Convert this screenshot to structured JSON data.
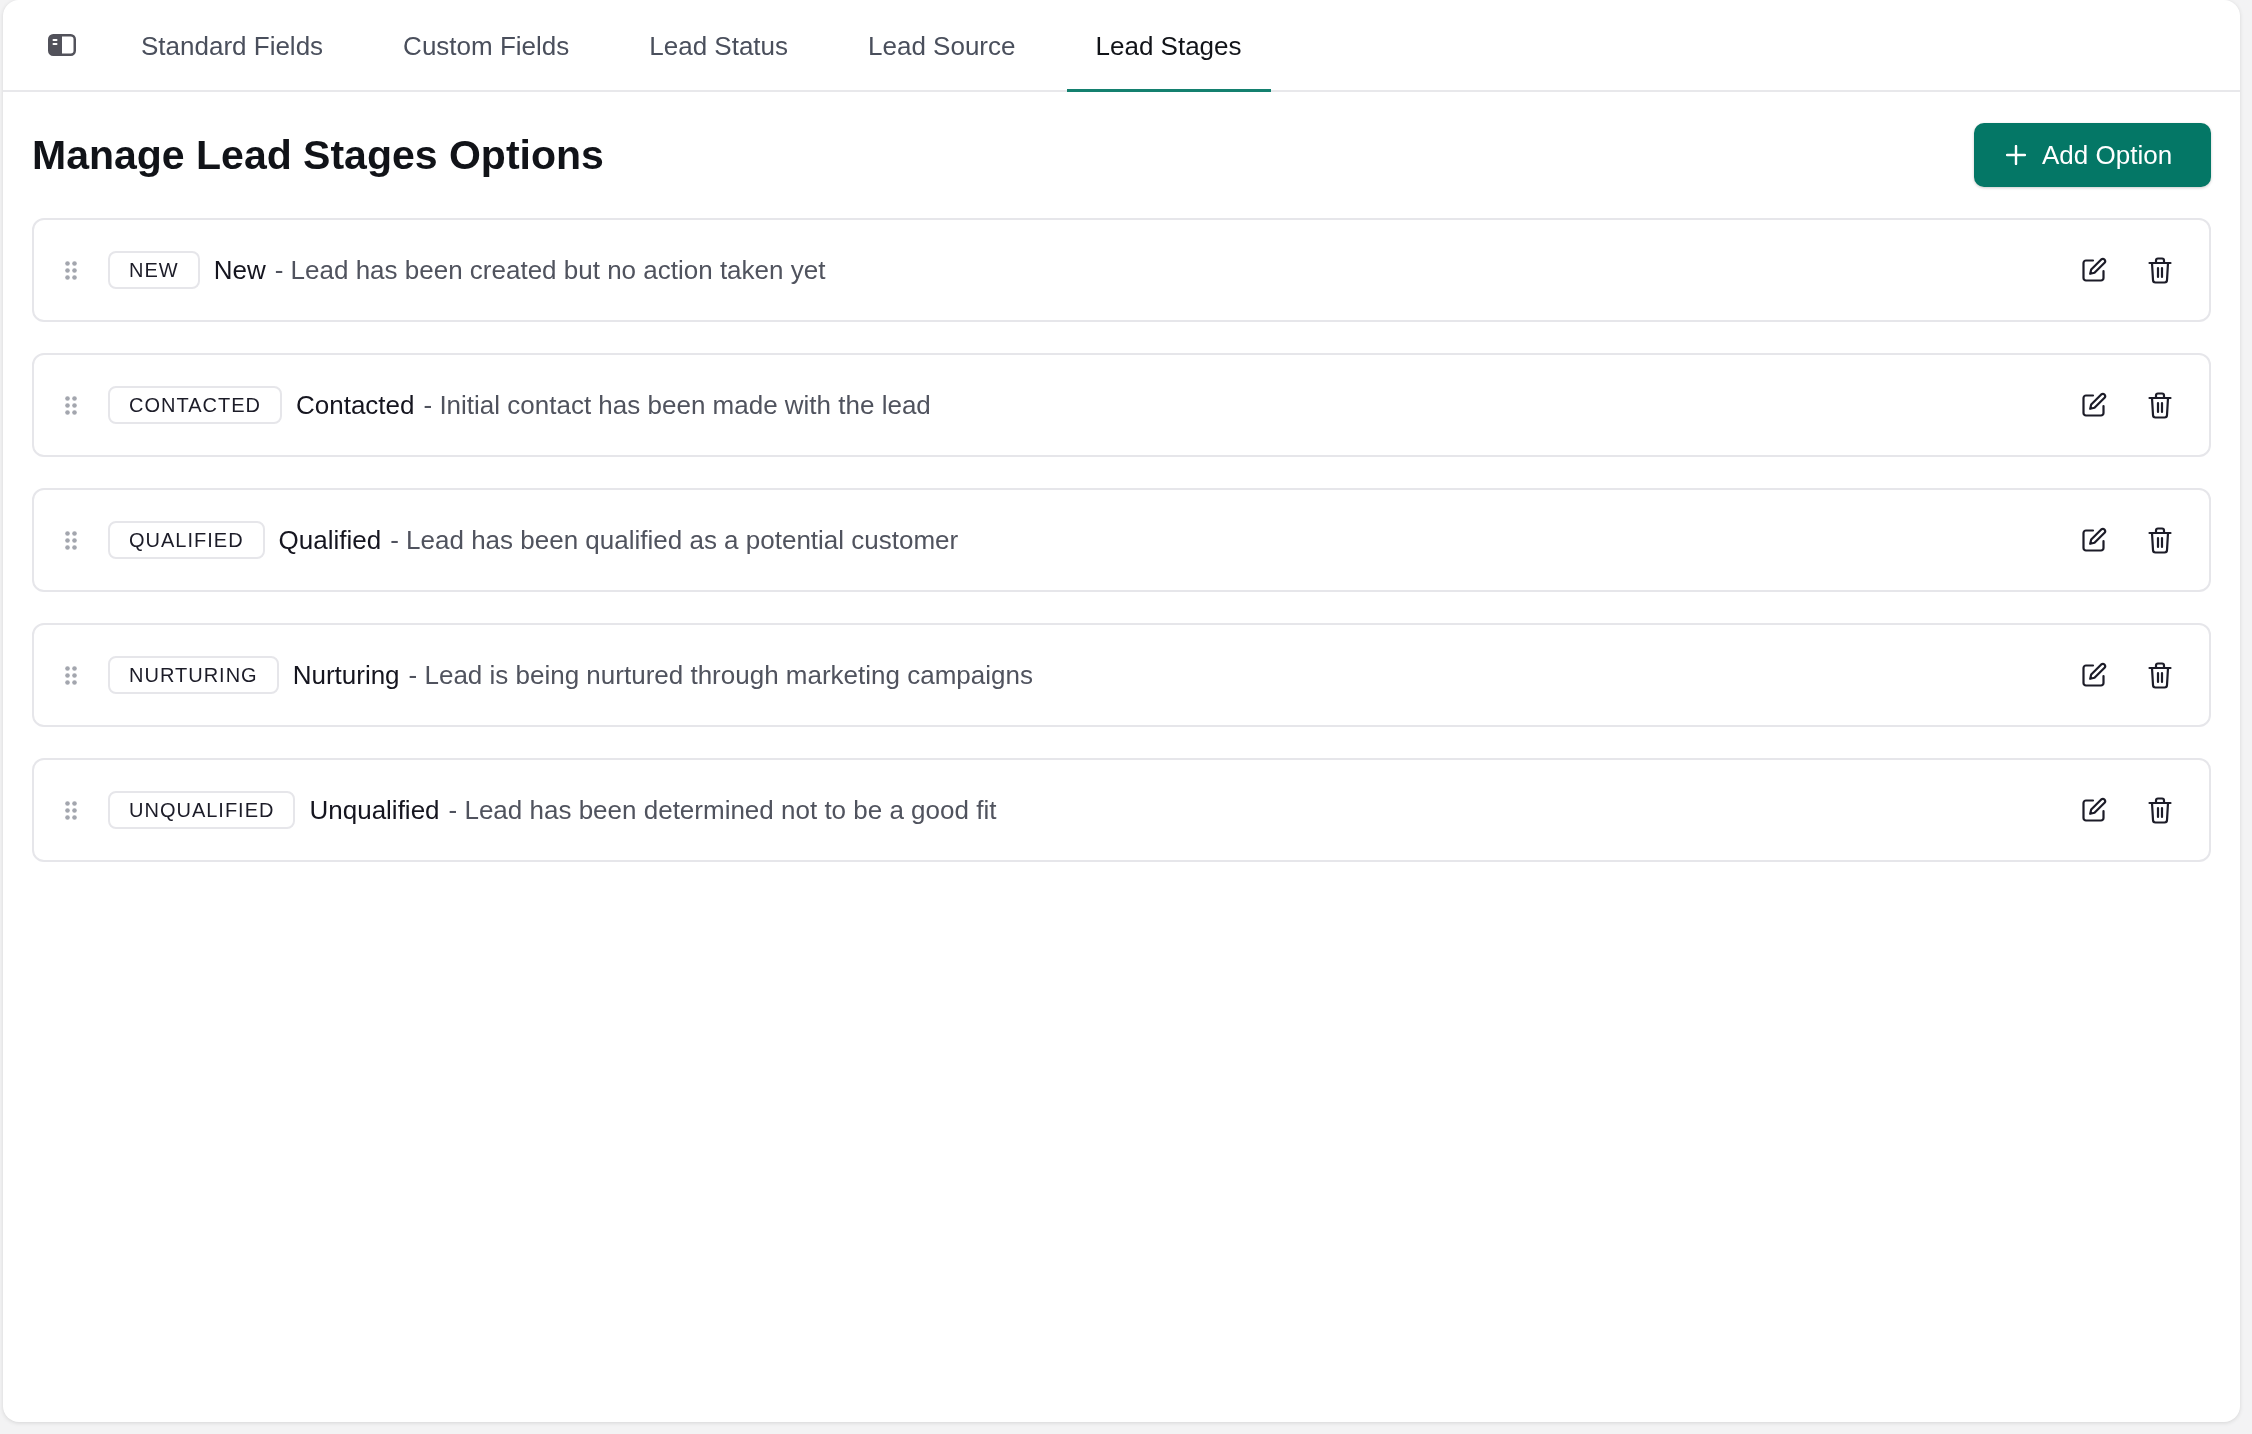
{
  "tabs": [
    {
      "label": "Standard Fields",
      "selected": false
    },
    {
      "label": "Custom Fields",
      "selected": false
    },
    {
      "label": "Lead Status",
      "selected": false
    },
    {
      "label": "Lead Source",
      "selected": false
    },
    {
      "label": "Lead Stages",
      "selected": true
    }
  ],
  "page_title": "Manage Lead Stages Options",
  "add_button": {
    "label": "Add Option"
  },
  "options": [
    {
      "code": "NEW",
      "label": "New",
      "description": "- Lead has been created but no action taken yet"
    },
    {
      "code": "CONTACTED",
      "label": "Contacted",
      "description": "- Initial contact has been made with the lead"
    },
    {
      "code": "QUALIFIED",
      "label": "Qualified",
      "description": "- Lead has been qualified as a potential customer"
    },
    {
      "code": "NURTURING",
      "label": "Nurturing",
      "description": "- Lead is being nurtured through marketing campaigns"
    },
    {
      "code": "UNQUALIFIED",
      "label": "Unqualified",
      "description": "- Lead has been determined not to be a good fit"
    }
  ]
}
